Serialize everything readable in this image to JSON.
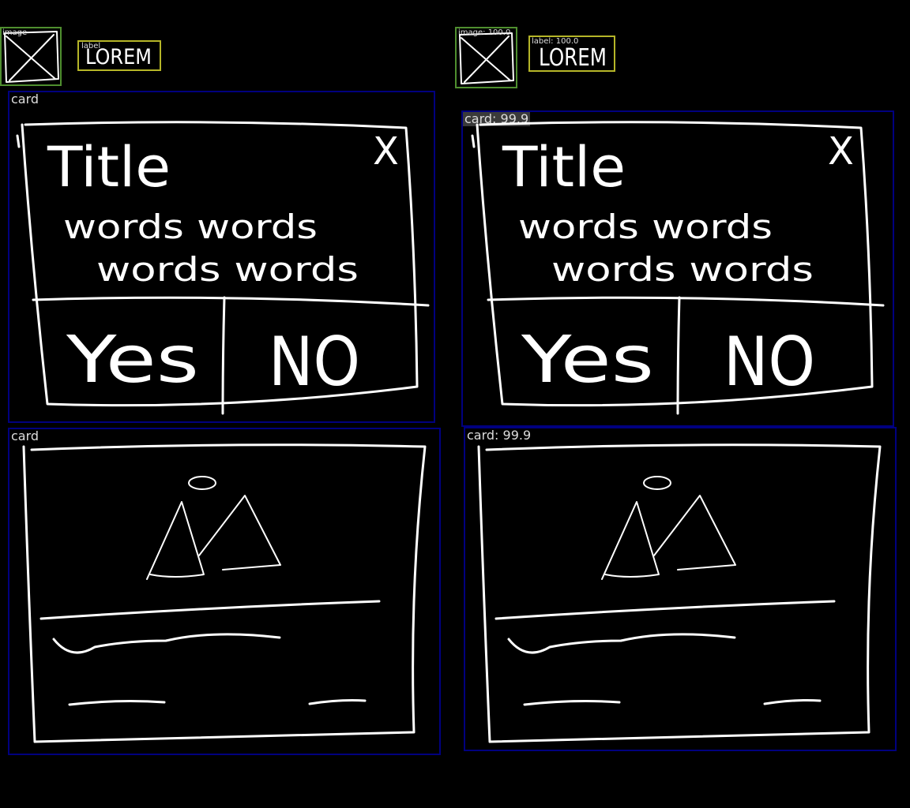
{
  "colors": {
    "background": "#000000",
    "card_box": "#00007f",
    "image_box": "#4f8f2f",
    "label_box": "#b5b528",
    "sketch": "#ffffff",
    "tag_text": "#dddddd"
  },
  "left": {
    "image_tag": "image",
    "label_tag": "label",
    "label_text": "LOREM",
    "dialog_card": {
      "tag": "card",
      "title": "Title",
      "close": "X",
      "body_line1": "words words",
      "body_line2": "words words",
      "yes": "Yes",
      "no": "NO"
    },
    "image_card": {
      "tag": "card"
    }
  },
  "right": {
    "image_tag": "image: 100.0",
    "label_tag": "label: 100.0",
    "label_text": "LOREM",
    "dialog_card": {
      "tag": "card: 99.9",
      "title": "Title",
      "close": "X",
      "body_line1": "words words",
      "body_line2": "words words",
      "yes": "Yes",
      "no": "NO"
    },
    "image_card": {
      "tag": "card: 99.9"
    }
  }
}
